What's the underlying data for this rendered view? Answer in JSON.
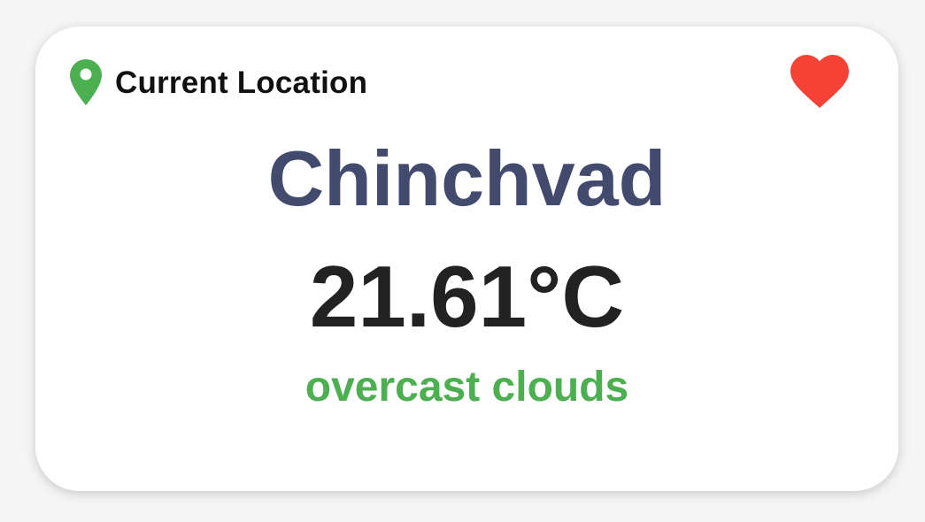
{
  "weather_card": {
    "location_label": "Current Location",
    "location_icon": "map-pin-icon",
    "favorite_icon": "heart-icon",
    "city": "Chinchvad",
    "temperature": "21.61°C",
    "description": "overcast clouds"
  },
  "colors": {
    "pin": "#4caf50",
    "heart": "#f44336",
    "city": "#424a6e",
    "temperature": "#222222",
    "description": "#4caf50"
  }
}
